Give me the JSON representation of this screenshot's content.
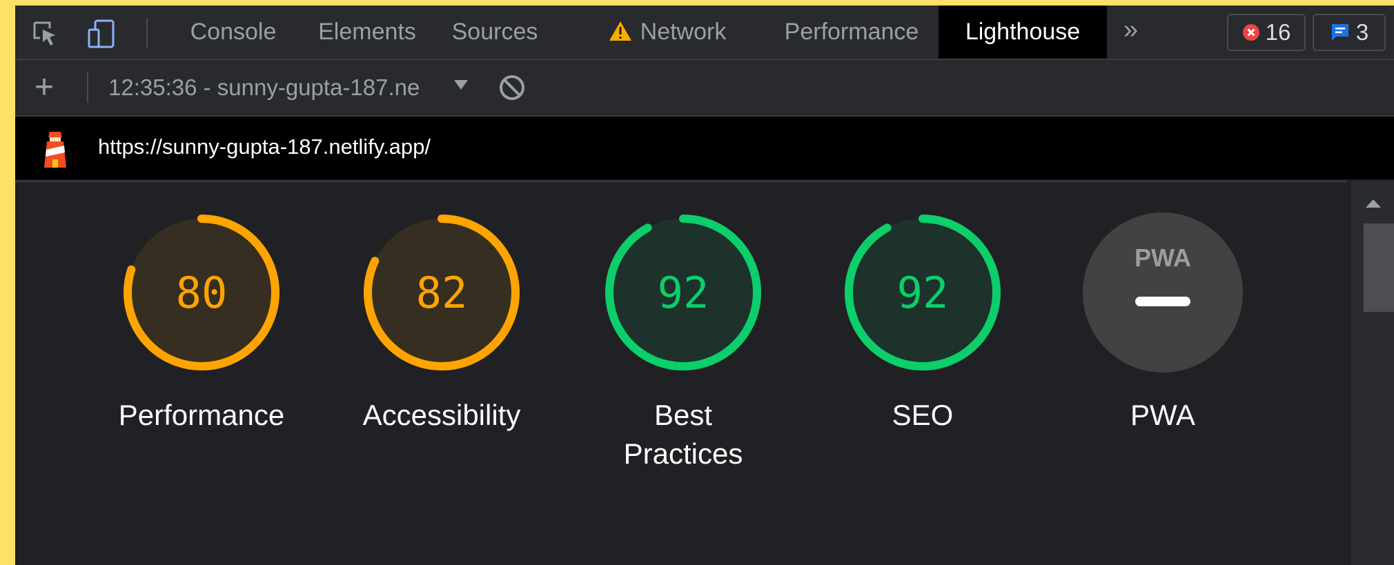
{
  "tabbar": {
    "tabs": [
      {
        "label": "Console"
      },
      {
        "label": "Elements"
      },
      {
        "label": "Sources"
      },
      {
        "label": "Network"
      },
      {
        "label": "Performance"
      },
      {
        "label": "Lighthouse"
      }
    ],
    "active_tab": "Lighthouse",
    "overflow": "»",
    "error_count": "16",
    "message_count": "3"
  },
  "toolbar": {
    "add": "+",
    "report_label": "12:35:36 - sunny-gupta-187.ne"
  },
  "urlbar": {
    "url": "https://sunny-gupta-187.netlify.app/"
  },
  "gauges": [
    {
      "label": "Performance",
      "score": "80",
      "value": 80,
      "color": "#ffa400"
    },
    {
      "label": "Accessibility",
      "score": "82",
      "value": 82,
      "color": "#ffa400"
    },
    {
      "label": "Best Practices",
      "score": "92",
      "value": 92,
      "color": "#0cce6b"
    },
    {
      "label": "SEO",
      "score": "92",
      "value": 92,
      "color": "#0cce6b"
    }
  ],
  "pwa": {
    "label": "PWA",
    "badge": "PWA"
  },
  "colors": {
    "average": "#ffa400",
    "pass": "#0cce6b",
    "pwa_bg": "#424242"
  }
}
